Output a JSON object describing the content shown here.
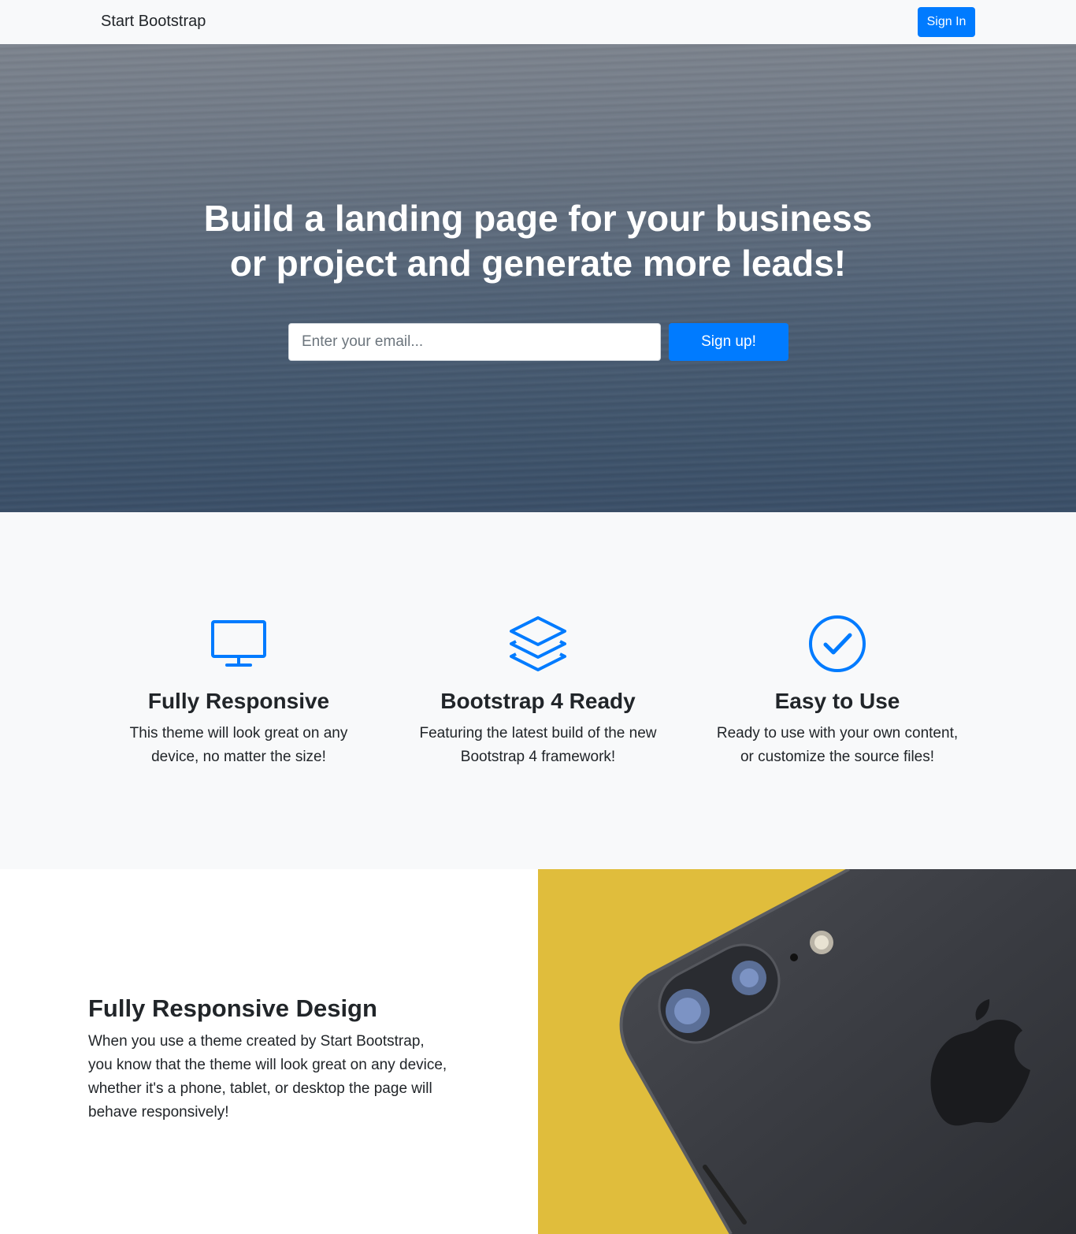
{
  "navbar": {
    "brand": "Start Bootstrap",
    "signin_label": "Sign In"
  },
  "hero": {
    "headline_line1": "Build a landing page for your business",
    "headline_line2": "or project and generate more leads!",
    "email_placeholder": "Enter your email...",
    "signup_label": "Sign up!"
  },
  "features": [
    {
      "icon": "desktop-icon",
      "title": "Fully Responsive",
      "line1": "This theme will look great on any",
      "line2": "device, no matter the size!"
    },
    {
      "icon": "layers-icon",
      "title": "Bootstrap 4 Ready",
      "line1": "Featuring the latest build of the new",
      "line2": "Bootstrap 4 framework!"
    },
    {
      "icon": "check-circle-icon",
      "title": "Easy to Use",
      "line1": "Ready to use with your own content,",
      "line2": "or customize the source files!"
    }
  ],
  "showcase": {
    "title": "Fully Responsive Design",
    "text": "When you use a theme created by Start Bootstrap, you know that the theme will look great on any device, whether it's a phone, tablet, or desktop the page will behave responsively!"
  },
  "colors": {
    "primary": "#007bff",
    "light": "#f8f9fa",
    "dark": "#212529"
  }
}
